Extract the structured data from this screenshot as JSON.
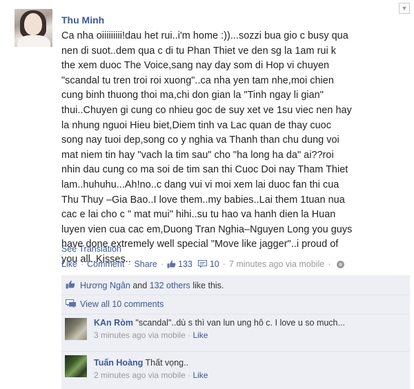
{
  "post": {
    "author": "Thu Minh",
    "message": "Ca nha oiiiiiiiii!dau het rui..i'm home :))...sozzi bua gio c busy qua\nnen di suot..dem qua c di tu Phan Thiet ve den sg la 1am rui k\nthe xem duoc The Voice,sang nay day som di Hop vi chuyen\n\"scandal tu tren troi roi xuong\"..ca nha yen tam nhe,moi chien\ncung binh thuong thoi ma,chi don gian la \"Tinh ngay li gian\"\nthui..Chuyen gi cung co nhieu goc de suy xet ve 1su viec nen hay\nla nhung nguoi Hieu biet,Diem tinh va Lac quan de thay cuoc\nsong nay tuoi dep,song co y nghia va Thanh than chu dung voi\nmat niem tin hay \"vach la tim sau\" cho \"ha long ha da\" ai??roi\nnhin dau cung co ma soi de tim san thi Cuoc Doi nay Tham Thiet\nlam..huhuhu...Ah!no..c dang vui vi moi xem lai duoc fan thi cua\nThu Thuy –Gia Bao..I love them..my babies..Lai them 1tuan nua\ncac e lai cho c \" mat mui\" hihi..su tu hao va hanh dien la Huan\nluyen vien cua cac em,Duong Tran Nghia–Nguyen Long you guys\nhave done extremely well special \"Move like jagger\"..i proud of\nyou all..Kisses..",
    "see_translation": "See Translation",
    "actions": {
      "like": "Like",
      "comment": "Comment",
      "share": "Share",
      "like_count": "133",
      "comment_count": "10",
      "time": "7 minutes ago via mobile",
      "sep": "·"
    }
  },
  "ufi": {
    "likers": {
      "name": "Hương Ngân",
      "and": "and",
      "others": "132 others",
      "suffix": "like this."
    },
    "view_all": "View all 10 comments",
    "comments": [
      {
        "name": "KAn Ròm",
        "text": "\"scandal\"..dù s thì van lun ung hô c. I love u so much...",
        "time": "3 minutes ago via mobile",
        "like": "Like"
      },
      {
        "name": "Tuấn Hoàng",
        "text": "Thất vọng..",
        "time": "2 minutes ago via mobile",
        "like": "Like"
      }
    ]
  },
  "colors": {
    "link": "#3b5998",
    "ufi_bg": "#edeff4",
    "meta": "#999999"
  },
  "icons": {
    "like": "thumbs-up-icon",
    "comment": "comment-bubble-icon",
    "privacy": "globe-icon",
    "menu": "chevron-down-icon"
  }
}
